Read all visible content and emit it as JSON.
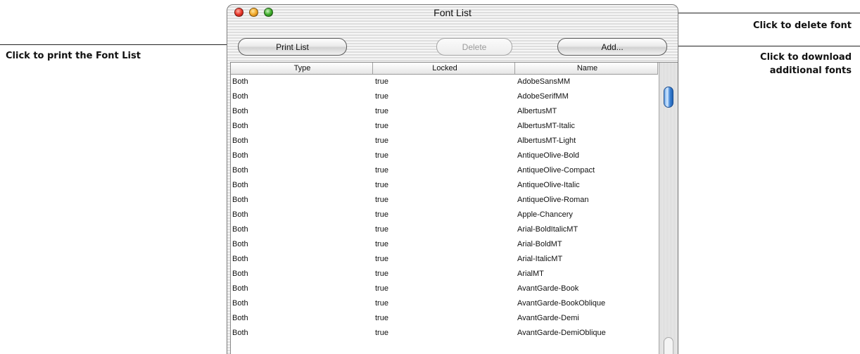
{
  "window": {
    "title": "Font List"
  },
  "toolbar": {
    "print_label": "Print List",
    "delete_label": "Delete",
    "add_label": "Add..."
  },
  "callouts": {
    "print": "Click to print the Font List",
    "delete": "Click to delete font",
    "add_line1": "Click to download",
    "add_line2": "additional fonts"
  },
  "table": {
    "columns": [
      "Type",
      "Locked",
      "Name"
    ],
    "rows": [
      [
        "Both",
        "true",
        "AdobeSansMM"
      ],
      [
        "Both",
        "true",
        "AdobeSerifMM"
      ],
      [
        "Both",
        "true",
        "AlbertusMT"
      ],
      [
        "Both",
        "true",
        "AlbertusMT-Italic"
      ],
      [
        "Both",
        "true",
        "AlbertusMT-Light"
      ],
      [
        "Both",
        "true",
        "AntiqueOlive-Bold"
      ],
      [
        "Both",
        "true",
        "AntiqueOlive-Compact"
      ],
      [
        "Both",
        "true",
        "AntiqueOlive-Italic"
      ],
      [
        "Both",
        "true",
        "AntiqueOlive-Roman"
      ],
      [
        "Both",
        "true",
        "Apple-Chancery"
      ],
      [
        "Both",
        "true",
        "Arial-BoldItalicMT"
      ],
      [
        "Both",
        "true",
        "Arial-BoldMT"
      ],
      [
        "Both",
        "true",
        "Arial-ItalicMT"
      ],
      [
        "Both",
        "true",
        "ArialMT"
      ],
      [
        "Both",
        "true",
        "AvantGarde-Book"
      ],
      [
        "Both",
        "true",
        "AvantGarde-BookOblique"
      ],
      [
        "Both",
        "true",
        "AvantGarde-Demi"
      ],
      [
        "Both",
        "true",
        "AvantGarde-DemiOblique"
      ]
    ]
  }
}
